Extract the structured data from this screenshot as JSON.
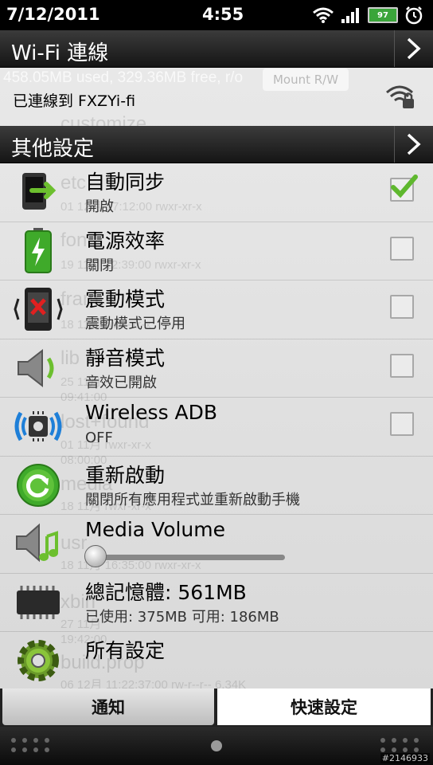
{
  "status_bar": {
    "date": "7/12/2011",
    "time": "4:55",
    "battery": "97"
  },
  "background_ghost": {
    "usage": "458.05MB used, 329.36MB free, r/o",
    "mount_button": "Mount R/W",
    "folders": [
      "customize",
      "etc",
      "fon",
      "fram",
      "lib",
      "lost+found",
      "media",
      "usr",
      "xbin",
      "build.prop"
    ],
    "meta": [
      "01 12月 17:12:00  rwxr-xr-x",
      "19 11月 12:39:00  rwxr-xr-x",
      "18 11月  rwxr-xr-x",
      "25 11月",
      "09:41:00",
      "01 11月  rwxr-xr-x",
      "08:00:00",
      "18 11月  rwxr-xr-x",
      "18 11月 16:35:00  rwxr-xr-x",
      "27 11月",
      "19:42:00",
      "06 12月 11:22:37:00  rw-r--r--  6.34K"
    ]
  },
  "wifi_section": {
    "header": "Wi-Fi 連線",
    "connected_text": "已連線到 FXZYi-fi"
  },
  "other_section": {
    "header": "其他設定"
  },
  "settings": [
    {
      "title": "自動同步",
      "sub": "開啟",
      "checked": true,
      "icon": "sync-icon"
    },
    {
      "title": "電源效率",
      "sub": "關閉",
      "checked": false,
      "icon": "battery-icon"
    },
    {
      "title": "震動模式",
      "sub": "震動模式已停用",
      "checked": false,
      "icon": "vibrate-icon"
    },
    {
      "title": "靜音模式",
      "sub": "音效已開啟",
      "checked": false,
      "icon": "speaker-icon"
    },
    {
      "title": "Wireless ADB",
      "sub": "OFF",
      "checked": false,
      "icon": "adb-icon"
    },
    {
      "title": "重新啟動",
      "sub": "關閉所有應用程式並重新啟動手機",
      "icon": "restart-icon"
    },
    {
      "title": "Media Volume",
      "volume_level": 0.0,
      "icon": "media-volume-icon"
    },
    {
      "title": "總記憶體: 561MB",
      "sub": "已使用: 375MB   可用: 186MB",
      "icon": "memory-chip-icon"
    },
    {
      "title": "所有設定",
      "icon": "gear-icon"
    }
  ],
  "tabs": {
    "notifications": "通知",
    "quick_settings": "快速設定"
  },
  "watermark": "#2146933",
  "colors": {
    "header_bg": "#1e1e1e",
    "check_green": "#5fb82e",
    "panel_bg": "#e4e4e4"
  }
}
